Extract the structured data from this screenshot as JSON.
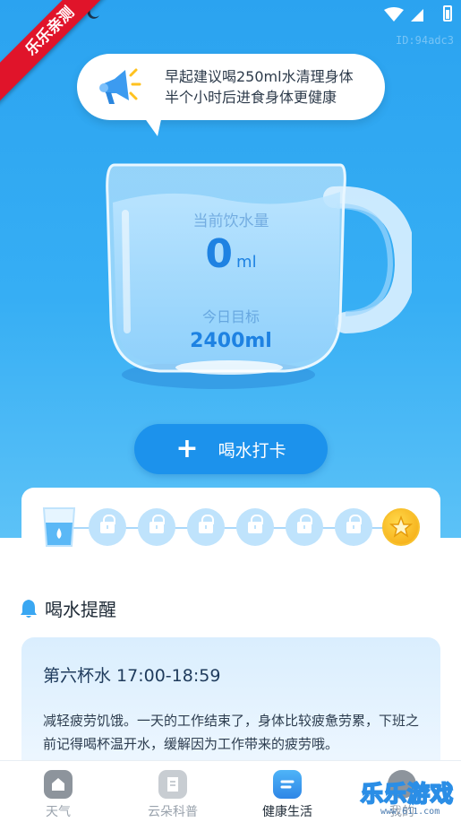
{
  "status_bar": {
    "device_id": "ID:94adc3"
  },
  "ribbon": {
    "text": "乐乐亲测"
  },
  "tip": {
    "line1": "早起建议喝250ml水清理身体",
    "line2": "半个小时后进食身体更健康",
    "icon": "megaphone-icon"
  },
  "cup": {
    "today_label": "当前饮水量",
    "today_value": "0",
    "today_unit": "ml",
    "goal_label": "今日目标",
    "goal_value": "2400ml"
  },
  "checkin_button": {
    "icon": "plus-icon",
    "label": "喝水打卡"
  },
  "progress": {
    "completed_cups": 0,
    "total_cups": 8
  },
  "reminder": {
    "section_title": "喝水提醒",
    "card_title": "第六杯水  17:00-18:59",
    "card_body": "减轻疲劳饥饿。一天的工作结束了，身体比较疲惫劳累，下班之前记得喝杯温开水，缓解因为工作带来的疲劳哦。"
  },
  "tabs": [
    {
      "label": "天气",
      "icon": "home-icon"
    },
    {
      "label": "云朵科普",
      "icon": "document-icon"
    },
    {
      "label": "健康生活",
      "icon": "health-icon",
      "active": true
    },
    {
      "label": "我的",
      "icon": "profile-icon"
    }
  ],
  "watermark": {
    "text": "乐乐游戏",
    "url": "www.611.com"
  },
  "colors": {
    "accent": "#1c92ec",
    "hero": "#2ba3f0",
    "ribbon": "#e0142a",
    "star": "#f4a70e"
  }
}
